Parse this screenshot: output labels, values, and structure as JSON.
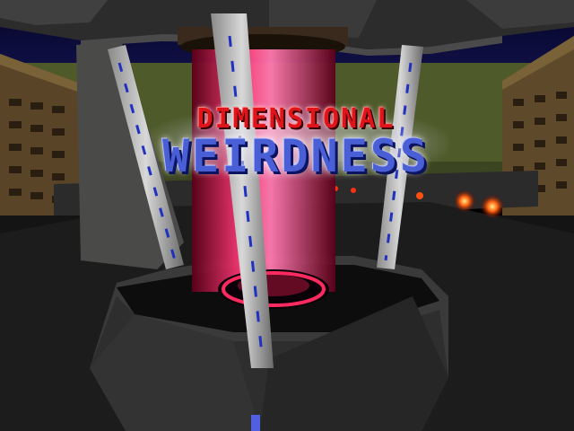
{
  "game": {
    "title_line1": "DIMENSIONAL",
    "title_line2": "WEIRDNESS"
  },
  "colors": {
    "portal_red": "#e01040",
    "title_red": "#e0141b",
    "title_blue": "#4a5fd6",
    "sky": "#0a0a40",
    "grass": "#4f5a2a"
  }
}
